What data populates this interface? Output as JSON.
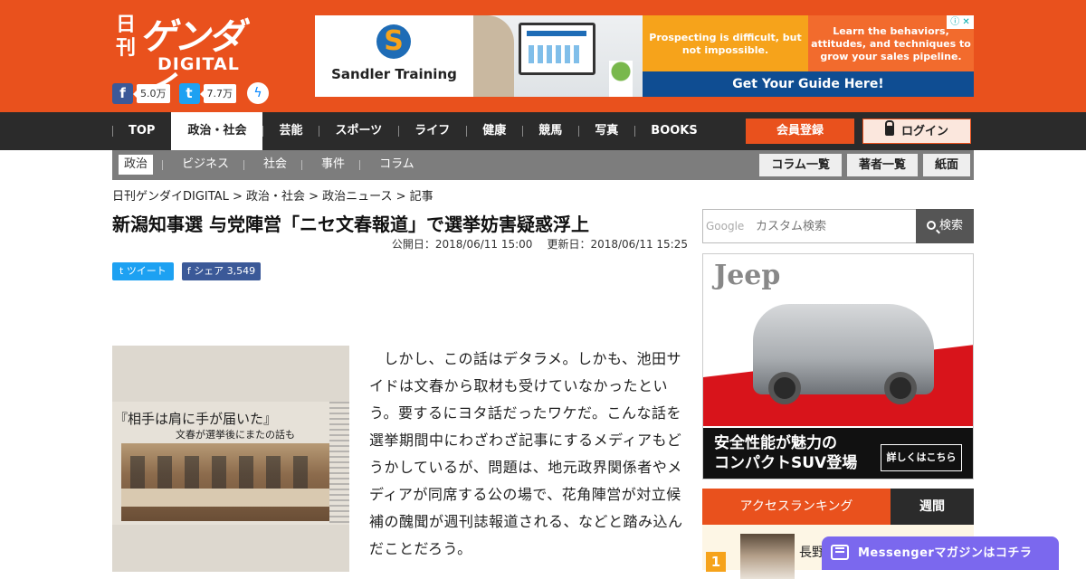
{
  "header": {
    "logo_nikkan": "日刊",
    "logo_gendai": "ゲンダイ",
    "logo_digital": "DIGITAL",
    "fb_count": "5.0万",
    "tw_count": "7.7万",
    "brand_color": "#e9511d"
  },
  "top_ad": {
    "advertiser": "Sandler Training",
    "yellow_text": "Prospecting is difficult, but not impossible.",
    "orange_text": "Learn the behaviors, attitudes, and techniques to grow your sales pipeline.",
    "cta": "Get Your Guide Here!",
    "adchoices": "ⓘ ✕"
  },
  "nav": {
    "items": [
      "TOP",
      "政治・社会",
      "芸能",
      "スポーツ",
      "ライフ",
      "健康",
      "競馬",
      "写真",
      "BOOKS"
    ],
    "register": "会員登録",
    "login": "ログイン"
  },
  "subnav": {
    "items": [
      "政治",
      "ビジネス",
      "社会",
      "事件",
      "コラム"
    ],
    "buttons": [
      "コラム一覧",
      "著者一覧",
      "紙面"
    ]
  },
  "breadcrumb": "日刊ゲンダイDIGITAL > 政治・社会 > 政治ニュース > 記事",
  "article": {
    "title": "新潟知事選 与党陣営「ニセ文春報道」で選挙妨害疑惑浮上",
    "published": "公開日：2018/06/11 15:00",
    "updated": "更新日：2018/06/11 15:25",
    "tweet_label": "ツイート",
    "share_label": "シェア 3,549",
    "photo_headline": "『相手は肩に手が届いた』",
    "photo_subhead": "文春が選挙後にまたの話も",
    "body": "しかし、この話はデタラメ。しかも、池田サイドは文春から取材も受けていなかったという。要するにヨタ話だったワケだ。こんな話を選挙期間中にわざわざ記事にするメディアもどうかしているが、問題は、地元政界関係者やメディアが同席する公の場で、花角陣営が対立候補の醜聞が週刊誌報道される、などと踏み込んだことだろう。"
  },
  "sidebar": {
    "search_brand": "Google",
    "search_placeholder": "カスタム検索",
    "search_button": "検索",
    "jeep_brand": "Jeep",
    "jeep_copy_1": "安全性能が魅力の",
    "jeep_copy_2": "コンパクトSUV登場",
    "jeep_more": "詳しくはこちら",
    "ranking_title": "アクセスランキング",
    "ranking_period": "週間",
    "rank1_num": "1",
    "rank1_text": "長野"
  },
  "messenger": {
    "label": "Messengerマガジンはコチラ"
  }
}
